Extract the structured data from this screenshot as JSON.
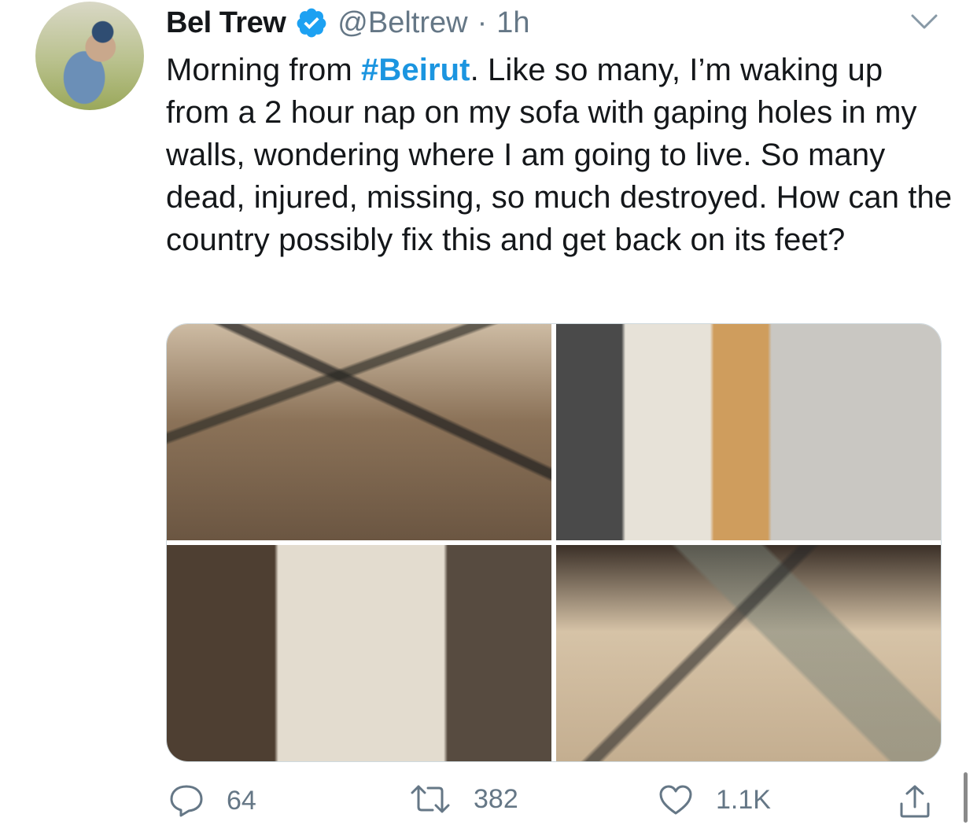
{
  "tweet": {
    "author_name": "Bel Trew",
    "handle": "@Beltrew",
    "separator": "·",
    "time": "1h",
    "text_before": "Morning from ",
    "hashtag": "#Beirut",
    "text_after": ". Like so many, I’m waking up from a 2 hour nap on my sofa with gaping holes in my walls, wondering where I am going to live. So many dead, injured,  missing, so much destroyed. How can the country possibly fix this and get back on its feet?"
  },
  "actions": {
    "replies": "64",
    "retweets": "382",
    "likes": "1.1K"
  },
  "colors": {
    "link": "#1b95e0",
    "verified": "#1da1f2",
    "muted": "#657786",
    "text": "#14171a"
  },
  "icons": [
    "verified-badge-icon",
    "chevron-down-icon",
    "reply-icon",
    "retweet-icon",
    "like-icon",
    "share-icon"
  ]
}
